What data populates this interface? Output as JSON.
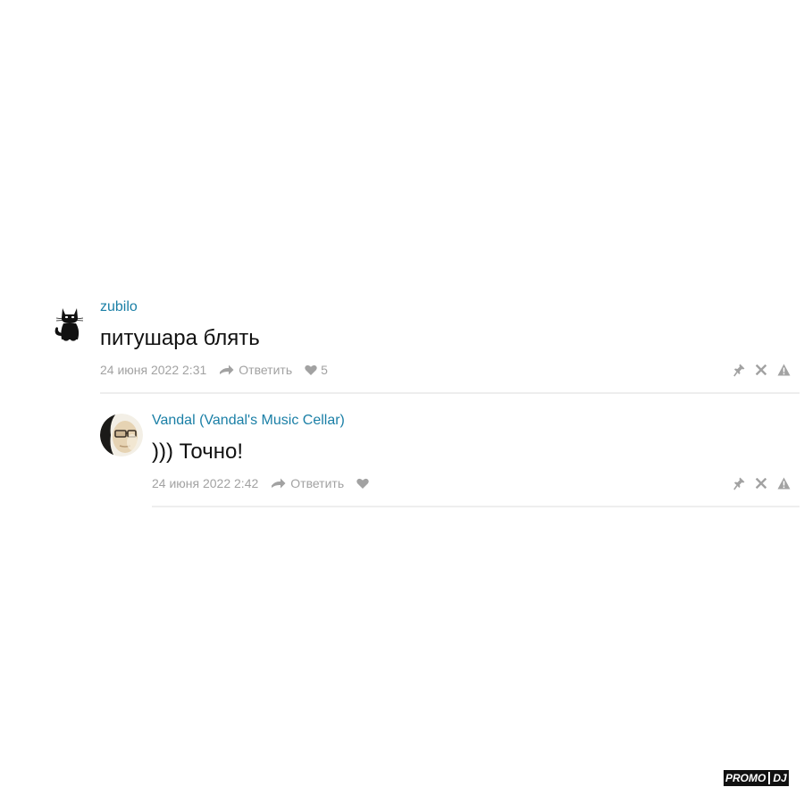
{
  "comments": [
    {
      "author": "zubilo",
      "avatar_icon": "black-cat-icon",
      "text": "питушара блять",
      "date": "24 июня 2022 2:31",
      "reply_label": "Ответить",
      "likes": "5"
    },
    {
      "author": "Vandal (Vandal's Music Cellar)",
      "avatar_icon": "user-photo",
      "text": "))) Точно!",
      "date": "24 июня 2022 2:42",
      "reply_label": "Ответить",
      "likes": ""
    }
  ],
  "action_icons": [
    "pin-icon",
    "close-icon",
    "warning-icon"
  ],
  "logo": {
    "part1": "PROMO",
    "part2": "DJ"
  },
  "colors": {
    "author_link": "#1a7fa6",
    "meta_text": "#a2a2a2",
    "comment_text": "#111111",
    "divider": "#eeeeee"
  }
}
